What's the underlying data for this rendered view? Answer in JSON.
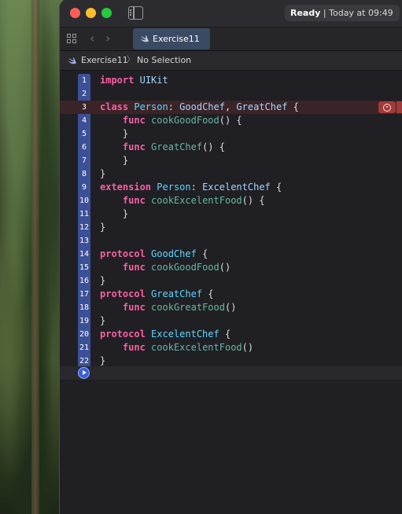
{
  "window": {
    "status": {
      "state": "Ready",
      "separator": "|",
      "time": "Today at 09:49"
    },
    "tab": {
      "label": "Exercise11",
      "icon": "swift-icon"
    },
    "jumpbar": {
      "file": "Exercise11",
      "chevron": "〉",
      "selection": "No Selection"
    }
  },
  "editor": {
    "lines": [
      {
        "num": "1",
        "text": "import UIKit"
      },
      {
        "num": "2",
        "text": ""
      },
      {
        "num": "3",
        "text": "class Person: GoodChef, GreatChef {"
      },
      {
        "num": "4",
        "text": "    func cookGoodFood() {"
      },
      {
        "num": "5",
        "text": "    }"
      },
      {
        "num": "6",
        "text": "    func GreatChef() {"
      },
      {
        "num": "7",
        "text": "    }"
      },
      {
        "num": "8",
        "text": "}"
      },
      {
        "num": "9",
        "text": "extension Person: ExcelentChef {"
      },
      {
        "num": "10",
        "text": "    func cookExcelentFood() {"
      },
      {
        "num": "11",
        "text": "    }"
      },
      {
        "num": "12",
        "text": "}"
      },
      {
        "num": "13",
        "text": ""
      },
      {
        "num": "14",
        "text": "protocol GoodChef {"
      },
      {
        "num": "15",
        "text": "    func cookGoodFood()"
      },
      {
        "num": "16",
        "text": "}"
      },
      {
        "num": "17",
        "text": "protocol GreatChef {"
      },
      {
        "num": "18",
        "text": "    func cookGreatFood()"
      },
      {
        "num": "19",
        "text": "}"
      },
      {
        "num": "20",
        "text": "protocol ExcelentChef {"
      },
      {
        "num": "21",
        "text": "    func cookExcelentFood()"
      },
      {
        "num": "22",
        "text": "}"
      }
    ],
    "error_line": "3",
    "error_icon": "error-circle-icon",
    "run_icon": "play-icon"
  },
  "colors": {
    "keyword": "#fc5fa3",
    "type": "#a3d7ff",
    "function": "#67b7a4",
    "gutter": "#3c5098",
    "tab_active": "#3a4a63",
    "error": "#a33a3a"
  }
}
